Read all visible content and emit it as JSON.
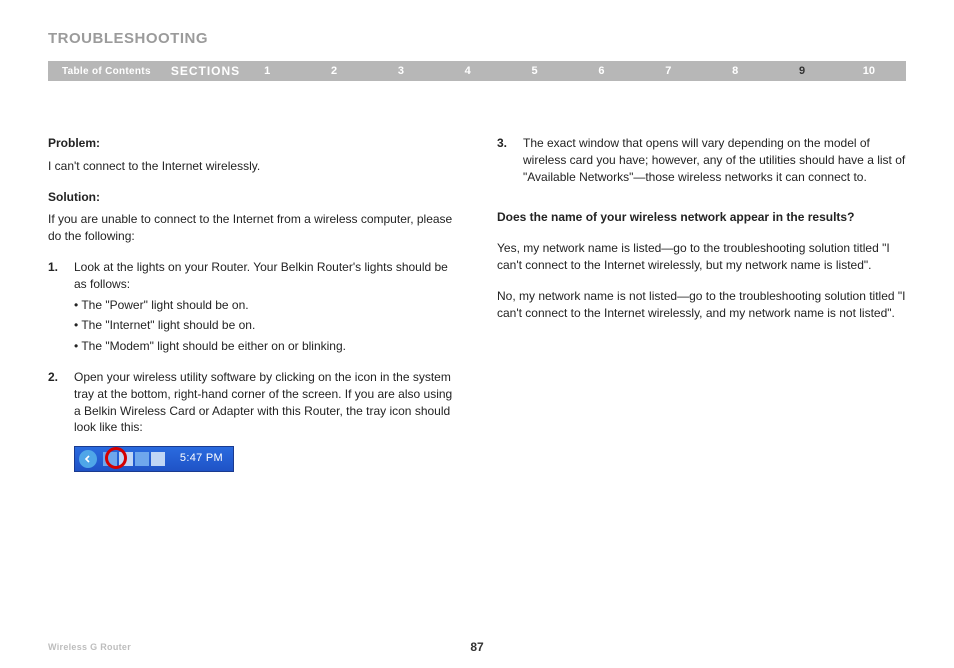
{
  "header": {
    "title": "TROUBLESHOOTING",
    "toc_label": "Table of Contents",
    "sections_label": "SECTIONS",
    "sections": [
      "1",
      "2",
      "3",
      "4",
      "5",
      "6",
      "7",
      "8",
      "9",
      "10"
    ],
    "active_section": "9"
  },
  "left": {
    "problem_label": "Problem:",
    "problem_text": "I can't connect to the Internet wirelessly.",
    "solution_label": "Solution:",
    "solution_intro": "If you are unable to connect to the Internet from a wireless computer, please do the following:",
    "step1_num": "1.",
    "step1_text": "Look at the lights on your Router. Your Belkin Router's lights should be as follows:",
    "step1_b1": "• The \"Power\" light should be on.",
    "step1_b2": "• The \"Internet\" light should be on.",
    "step1_b3": "• The \"Modem\" light should be either on or blinking.",
    "step2_num": "2.",
    "step2_text": "Open your wireless utility software by clicking on the icon in the system tray at the bottom, right-hand corner of the screen. If you are also using a Belkin Wireless Card or Adapter with this Router, the tray icon should look like this:",
    "tray_time": "5:47 PM"
  },
  "right": {
    "step3_num": "3.",
    "step3_text": "The exact window that opens will vary depending on the model of wireless card you have; however, any of the utilities should have a list of \"Available Networks\"—those wireless networks it can connect to.",
    "question": "Does the name of your wireless network appear in the results?",
    "answer_yes": "Yes, my network name is listed—go to the troubleshooting solution titled \"I can't connect to the Internet wirelessly, but my network name is listed\".",
    "answer_no": "No, my network name is not listed—go to the troubleshooting solution titled \"I can't connect to the Internet wirelessly, and my network name is not listed\"."
  },
  "footer": {
    "product": "Wireless G Router",
    "page": "87"
  }
}
